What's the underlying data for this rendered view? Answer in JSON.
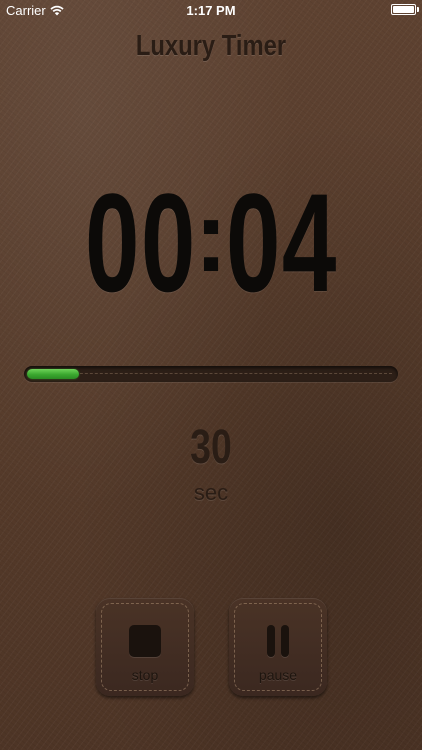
{
  "status_bar": {
    "carrier": "Carrier",
    "time": "1:17 PM",
    "wifi_icon": "wifi-icon",
    "battery_icon": "battery-icon"
  },
  "app": {
    "title": "Luxury Timer"
  },
  "timer": {
    "minutes": "00",
    "separator": ":",
    "seconds": "04",
    "progress_fraction": 0.14
  },
  "duration": {
    "value": "30",
    "unit": "sec"
  },
  "controls": {
    "stop_label": "stop",
    "stop_icon": "stop-icon",
    "pause_label": "pause",
    "pause_icon": "pause-icon"
  },
  "colors": {
    "leather": "#5a3f2e",
    "progress": "#3aa82f",
    "text_dark": "#2a1d15"
  }
}
